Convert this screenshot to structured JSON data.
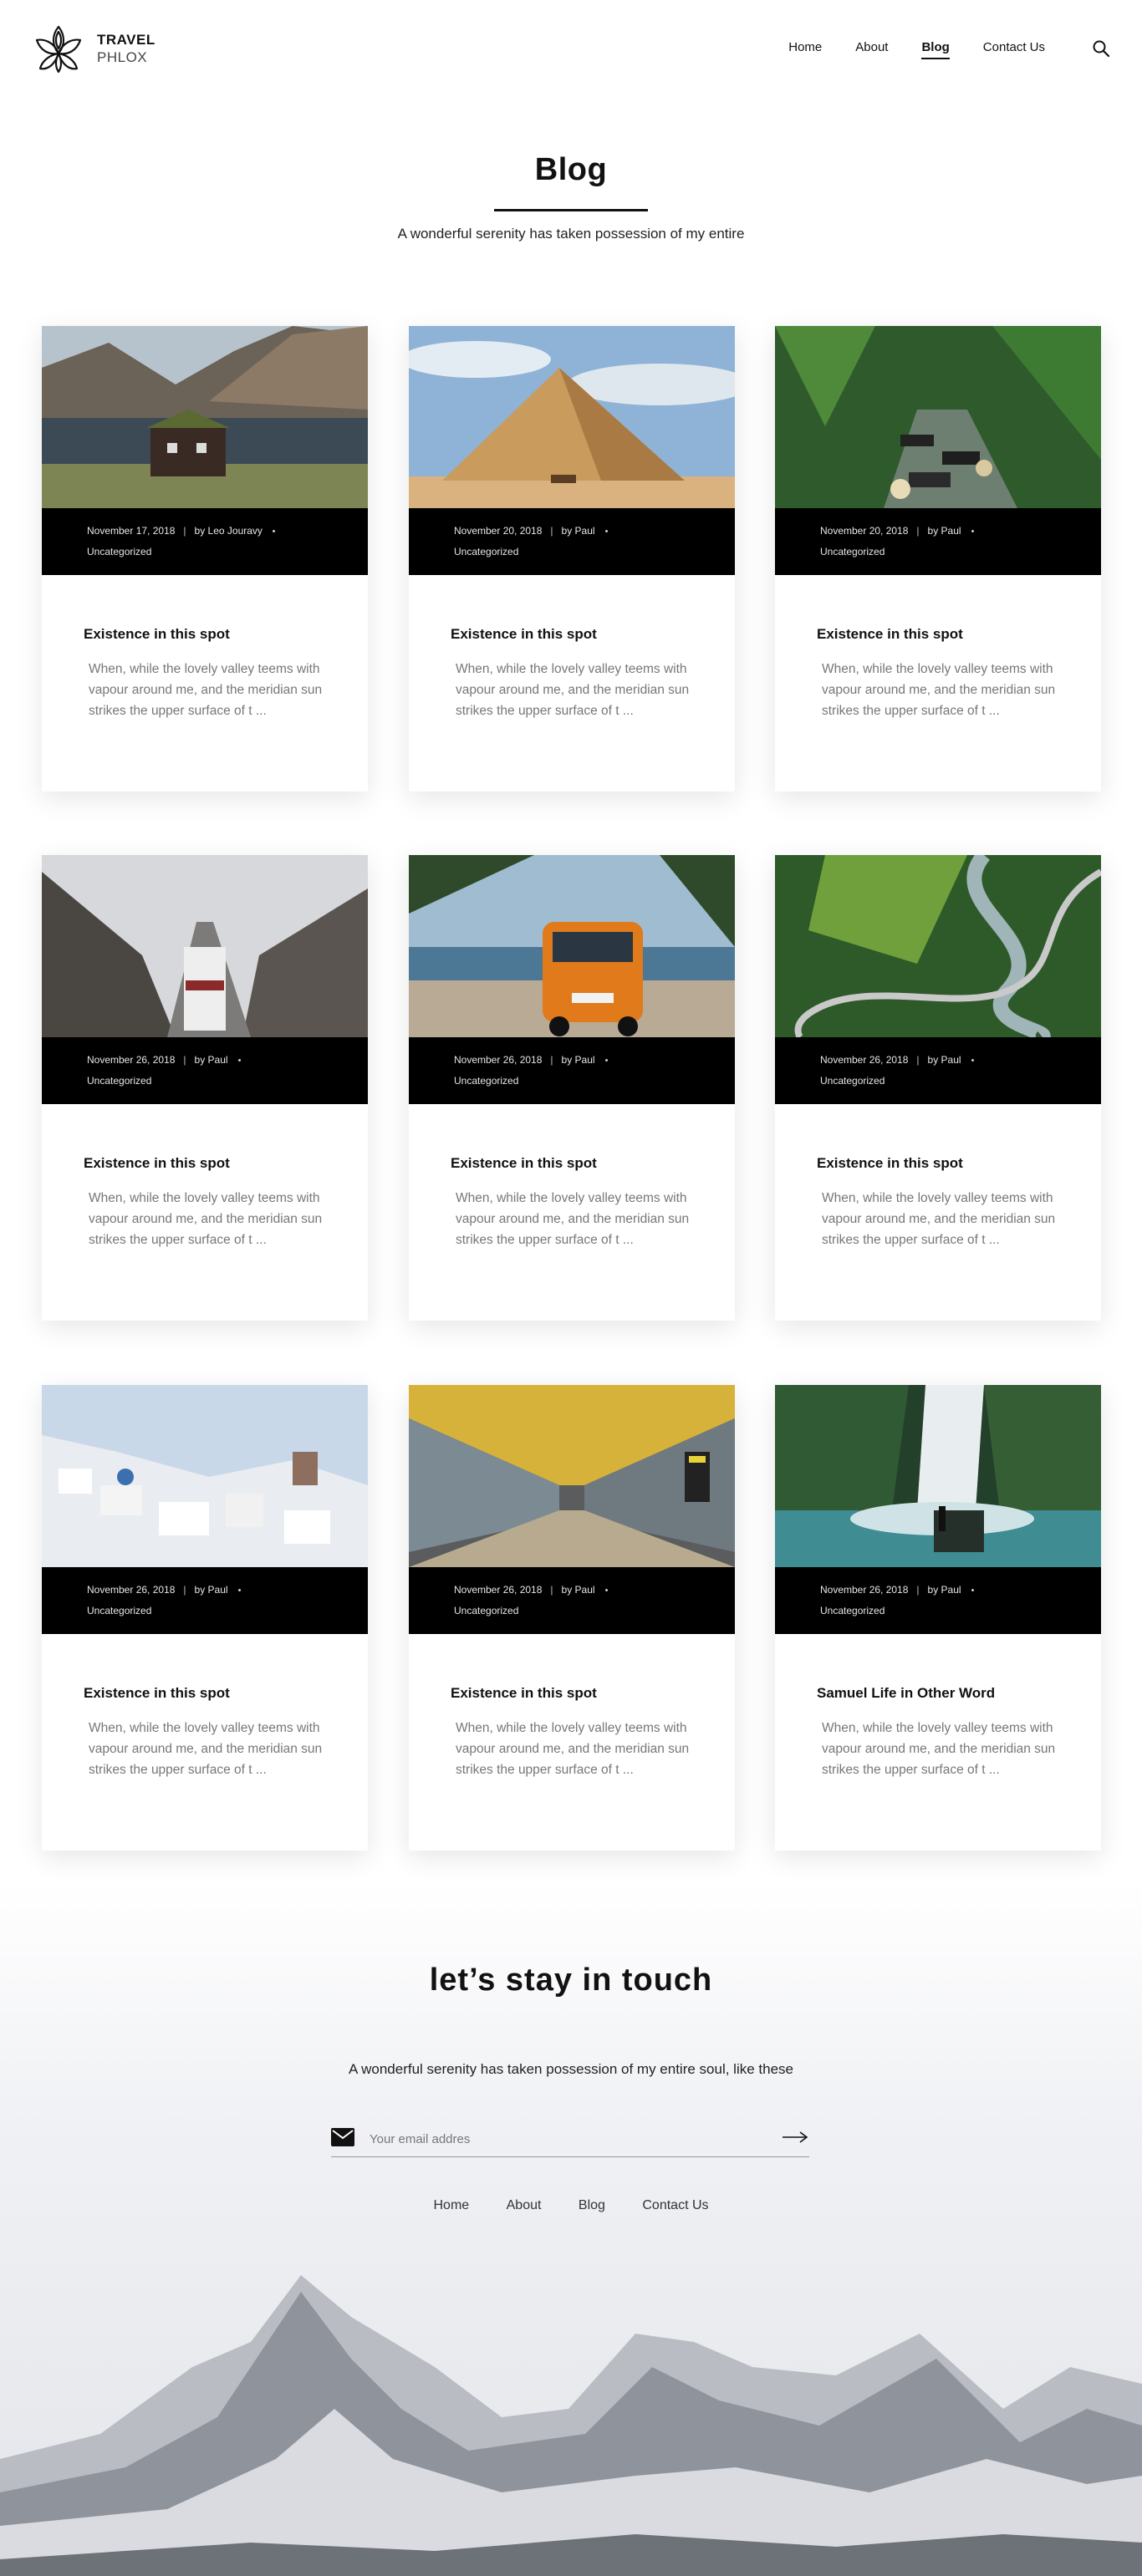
{
  "brand": {
    "line1": "TRAVEL",
    "line2": "PHLOX"
  },
  "nav": {
    "items": [
      {
        "label": "Home",
        "active": false
      },
      {
        "label": "About",
        "active": false
      },
      {
        "label": "Blog",
        "active": true
      },
      {
        "label": "Contact Us",
        "active": false
      }
    ]
  },
  "search": {
    "icon": "search-icon"
  },
  "page": {
    "title": "Blog",
    "subtitle": "A wonderful serenity has taken possession of my entire"
  },
  "posts": [
    {
      "date": "November 17, 2018",
      "author": "by Leo Jouravy",
      "category": "Uncategorized",
      "title": "Existence in this spot",
      "excerpt": "When, while the lovely valley teems with vapour around me, and the meridian sun strikes the upper surface of t ..."
    },
    {
      "date": "November 20, 2018",
      "author": "by Paul",
      "category": "Uncategorized",
      "title": "Existence in this spot",
      "excerpt": "When, while the lovely valley teems with vapour around me, and the meridian sun strikes the upper surface of t ..."
    },
    {
      "date": "November 20, 2018",
      "author": "by Paul",
      "category": "Uncategorized",
      "title": "Existence in this spot",
      "excerpt": "When, while the lovely valley teems with vapour around me, and the meridian sun strikes the upper surface of t ..."
    },
    {
      "date": "November 26, 2018",
      "author": "by Paul",
      "category": "Uncategorized",
      "title": "Existence in this spot",
      "excerpt": "When, while the lovely valley teems with vapour around me, and the meridian sun strikes the upper surface of t ..."
    },
    {
      "date": "November 26, 2018",
      "author": "by Paul",
      "category": "Uncategorized",
      "title": "Existence in this spot",
      "excerpt": "When, while the lovely valley teems with vapour around me, and the meridian sun strikes the upper surface of t ..."
    },
    {
      "date": "November 26, 2018",
      "author": "by Paul",
      "category": "Uncategorized",
      "title": "Existence in this spot",
      "excerpt": "When, while the lovely valley teems with vapour around me, and the meridian sun strikes the upper surface of t ..."
    },
    {
      "date": "November 26, 2018",
      "author": "by Paul",
      "category": "Uncategorized",
      "title": "Existence in this spot",
      "excerpt": "When, while the lovely valley teems with vapour around me, and the meridian sun strikes the upper surface of t ..."
    },
    {
      "date": "November 26, 2018",
      "author": "by Paul",
      "category": "Uncategorized",
      "title": "Existence in this spot",
      "excerpt": "When, while the lovely valley teems with vapour around me, and the meridian sun strikes the upper surface of t ..."
    },
    {
      "date": "November 26, 2018",
      "author": "by Paul",
      "category": "Uncategorized",
      "title": "Samuel Life in Other Word",
      "excerpt": "When, while the lovely valley teems with vapour around me, and the meridian sun strikes the upper surface of t ..."
    }
  ],
  "footer": {
    "title": "let’s stay in touch",
    "subtitle": "A wonderful serenity has taken possession of my entire soul, like these",
    "email_placeholder": "Your email addres",
    "nav": [
      "Home",
      "About",
      "Blog",
      "Contact Us"
    ]
  },
  "colors": {
    "text": "#111111",
    "meta_bg": "#000000",
    "excerpt": "#777777",
    "footer_bg": "#e3e5ea"
  }
}
